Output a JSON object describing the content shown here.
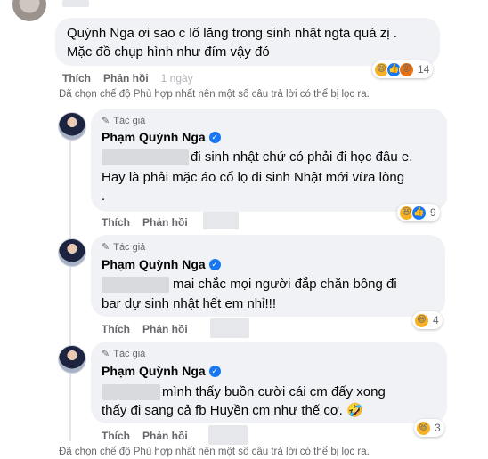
{
  "top_comment": {
    "lines": [
      "Quỳnh Nga ơi sao c lố lăng trong sinh nhật ngta quá zị .",
      "Mặc đồ chụp hình như đím vậy đó"
    ],
    "actions": {
      "like": "Thích",
      "reply": "Phản hồi",
      "time": "1 ngày"
    },
    "reactions": {
      "icons": [
        "haha",
        "like",
        "angry"
      ],
      "count": "14"
    }
  },
  "filter_note_top": "Đã chọn chế độ Phù hợp nhất nên một số câu trả lời có thể bị lọc ra.",
  "replies": [
    {
      "author_badge": "Tác giả",
      "name": "Phạm Quỳnh Nga",
      "lines": [
        "đi sinh nhật chứ có phải đi học đâu e.",
        "Hay là phải mặc áo cổ lọ đi sinh Nhật mới vừa lòng",
        "."
      ],
      "actions": {
        "like": "Thích",
        "reply": "Phản hồi"
      },
      "reactions": {
        "icons": [
          "haha",
          "like"
        ],
        "count": "9"
      }
    },
    {
      "author_badge": "Tác giả",
      "name": "Phạm Quỳnh Nga",
      "lines": [
        "mai chắc mọi người đắp chăn bông đi",
        "bar dự sinh nhật hết em nhỉ!!!"
      ],
      "actions": {
        "like": "Thích",
        "reply": "Phản hồi"
      },
      "reactions": {
        "icons": [
          "haha"
        ],
        "count": "4"
      }
    },
    {
      "author_badge": "Tác giả",
      "name": "Phạm Quỳnh Nga",
      "lines": [
        "mình thấy buồn cười cái cm đấy xong",
        "thấy đi sang cả fb Huyền cm như thế cơ. 🤣"
      ],
      "actions": {
        "like": "Thích",
        "reply": "Phản hồi"
      },
      "reactions": {
        "icons": [
          "haha"
        ],
        "count": "3"
      }
    }
  ],
  "filter_note_bottom": "Đã chọn chế độ Phù hợp nhất nên một số câu trả lời có thể bị lọc ra.",
  "icons": {
    "author": "pen-icon",
    "verified": "verified-check-icon",
    "haha": "😆",
    "like": "👍",
    "angry": "😡"
  }
}
